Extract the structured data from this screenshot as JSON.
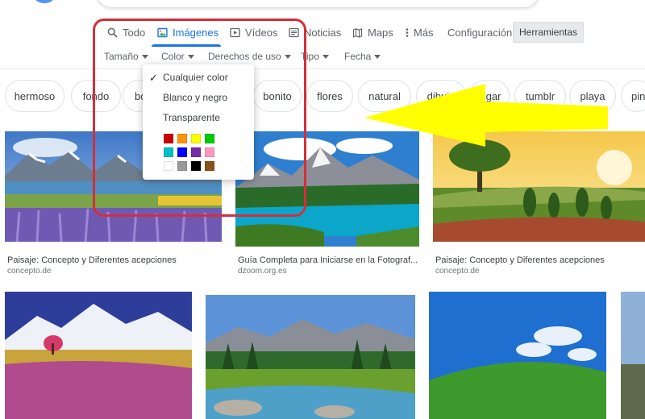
{
  "tabs": [
    {
      "label": "Todo",
      "icon": "search-icon"
    },
    {
      "label": "Imágenes",
      "icon": "image-icon",
      "active": true
    },
    {
      "label": "Vídeos",
      "icon": "play-icon"
    },
    {
      "label": "Noticias",
      "icon": "news-icon"
    },
    {
      "label": "Maps",
      "icon": "map-icon"
    },
    {
      "label": "Más",
      "icon": "more-vert-icon"
    }
  ],
  "settings_label": "Configuración",
  "tools_label": "Herramientas",
  "filters": [
    "Tamaño",
    "Color",
    "Derechos de uso",
    "Tipo",
    "Fecha"
  ],
  "chips": [
    "hermoso",
    "fondo",
    "bo",
    "bonito",
    "flores",
    "natural",
    "dibujo",
    "lugar",
    "tumblr",
    "playa",
    "pin"
  ],
  "color_menu": {
    "items": [
      "Cualquier color",
      "Blanco y negro",
      "Transparente"
    ],
    "selected": "Cualquier color",
    "swatches": [
      "#cc0000",
      "#fb940b",
      "#ffff00",
      "#00cc00",
      "#03c0c6",
      "#0000ff",
      "#762ca7",
      "#ff98bf",
      "#ffffff",
      "#999999",
      "#000000",
      "#885418"
    ]
  },
  "results_row1": [
    {
      "caption": "Paisaje: Concepto y Diferentes acepciones",
      "source": "concepto.de"
    },
    {
      "caption": "Guía Completa para Iniciarse en la Fotograf...",
      "source": "dzoom.org.es"
    },
    {
      "caption": "Paisaje: Concepto y Diferentes acepciones",
      "source": "concepto.de"
    }
  ],
  "colors": {
    "accent": "#1a73e8",
    "highlight_frame": "#d32f3a",
    "arrow": "#ffff00"
  }
}
